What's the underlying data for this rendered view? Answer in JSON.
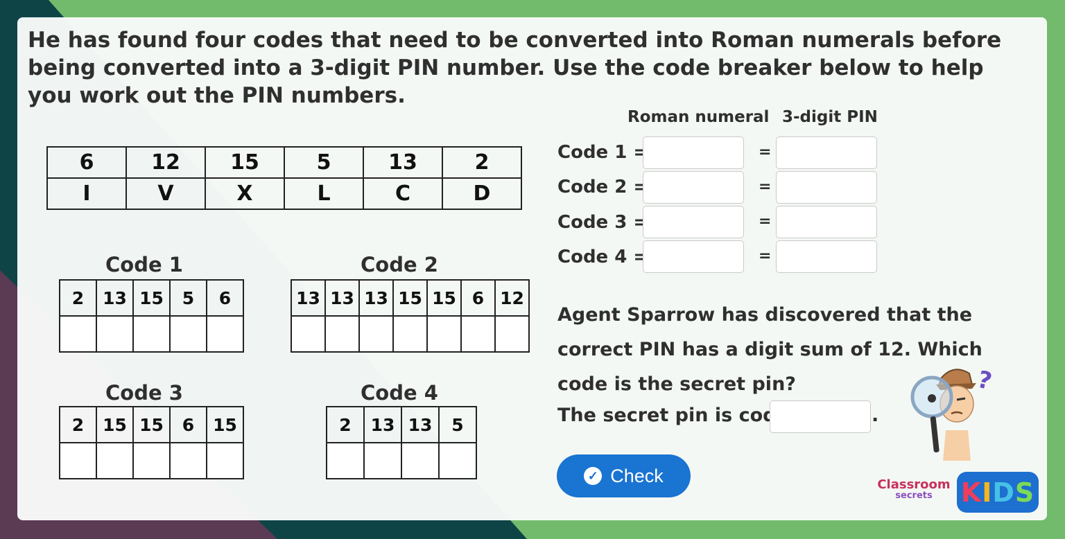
{
  "intro_text": "He has found four codes that need to be converted into Roman numerals before being converted into a 3-digit PIN number. Use the code breaker below to help you work out the PIN numbers.",
  "key_table": {
    "numbers": [
      "6",
      "12",
      "15",
      "5",
      "13",
      "2"
    ],
    "numerals": [
      "I",
      "V",
      "X",
      "L",
      "C",
      "D"
    ]
  },
  "codes": {
    "code1": {
      "title": "Code 1",
      "values": [
        "2",
        "13",
        "15",
        "5",
        "6"
      ]
    },
    "code2": {
      "title": "Code 2",
      "values": [
        "13",
        "13",
        "13",
        "15",
        "15",
        "6",
        "12"
      ]
    },
    "code3": {
      "title": "Code 3",
      "values": [
        "2",
        "15",
        "15",
        "6",
        "15"
      ]
    },
    "code4": {
      "title": "Code 4",
      "values": [
        "2",
        "13",
        "13",
        "5"
      ]
    }
  },
  "answers": {
    "heading_roman": "Roman numeral",
    "heading_pin": "3-digit PIN",
    "equals": "=",
    "rows": [
      {
        "label": "Code 1 ="
      },
      {
        "label": "Code 2 ="
      },
      {
        "label": "Code 3 ="
      },
      {
        "label": "Code 4 ="
      }
    ]
  },
  "question_text": "Agent Sparrow has discovered that the correct PIN has a digit sum of 12. Which code is the secret pin?",
  "secret_label": "The secret pin is code",
  "secret_end": ".",
  "check_button": {
    "label": "Check",
    "icon": "checkmark-icon"
  },
  "logo": {
    "line1": "Classroom",
    "line2": "secrets",
    "kids": [
      "K",
      "I",
      "D",
      "S"
    ]
  },
  "colors": {
    "button": "#1a74d1",
    "background_green": "#72bb6c",
    "background_teal": "#0f4447"
  }
}
